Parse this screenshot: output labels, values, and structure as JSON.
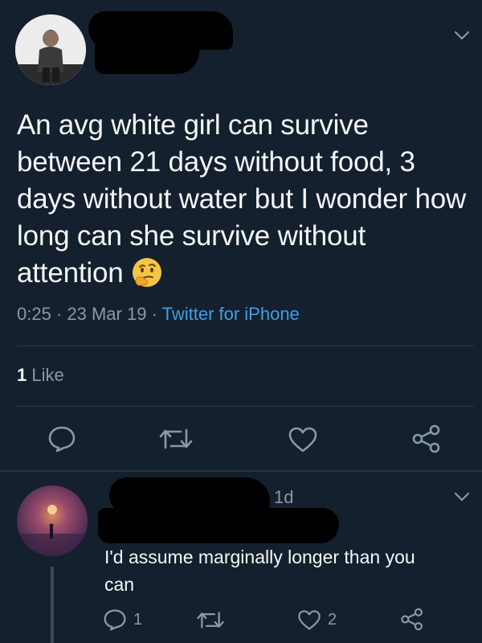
{
  "tweet": {
    "text": "An avg white girl can survive between 21 days without food, 3 days without water but I wonder how long can she survive without attention",
    "emoji": "thinking-face",
    "time": "0:25",
    "date": "23 Mar 19",
    "source": "Twitter for iPhone",
    "likes_count": "1",
    "likes_label": "Like"
  },
  "actions": {
    "icons": [
      "reply-icon",
      "retweet-icon",
      "like-icon",
      "share-icon"
    ]
  },
  "reply": {
    "time": "1d",
    "text": "I'd assume marginally longer than you can",
    "reply_count": "1",
    "like_count": "2"
  },
  "colors": {
    "background": "#14202d",
    "text": "#f5f7f9",
    "secondary": "#8899a6",
    "link": "#3d9fe6",
    "divider": "#2d3a47"
  }
}
